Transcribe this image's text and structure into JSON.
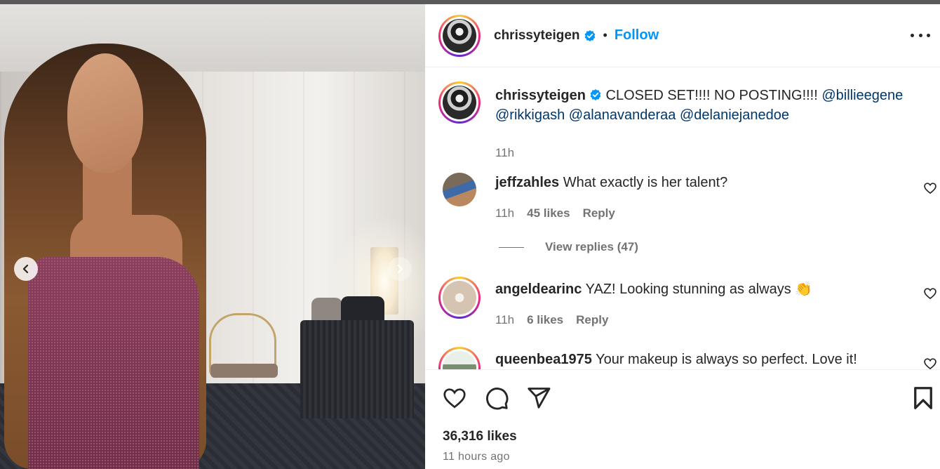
{
  "post": {
    "author": "chrissyteigen",
    "follow_label": "Follow",
    "separator": "•",
    "caption": {
      "username": "chrissyteigen",
      "text": "CLOSED SET!!!! NO POSTING!!!!",
      "mentions_line1": "@billieegene",
      "mentions_line2": [
        "@rikkigash",
        "@alanavanderaa",
        "@delaniejanedoe"
      ],
      "time": "11h"
    },
    "likes": "36,316 likes",
    "posted": "11 hours ago"
  },
  "comments": [
    {
      "username": "jeffzahles",
      "text": "What exactly is her talent?",
      "time": "11h",
      "likes": "45 likes",
      "reply": "Reply",
      "view_replies": "View replies (47)"
    },
    {
      "username": "angeldearinc",
      "text": "YAZ! Looking stunning as always 👏",
      "time": "11h",
      "likes": "6 likes",
      "reply": "Reply"
    },
    {
      "username": "queenbea1975",
      "text": "Your makeup is always so perfect. Love it!"
    }
  ],
  "icons": {
    "verified": "verified-badge-icon",
    "more": "more-options-icon",
    "like": "heart-icon",
    "comment": "comment-icon",
    "share": "share-icon",
    "save": "bookmark-icon",
    "prev": "chevron-left-icon",
    "next": "chevron-right-icon"
  },
  "colors": {
    "accent": "#0095f6",
    "mention": "#00376b",
    "muted": "#737373",
    "text": "#262626"
  }
}
